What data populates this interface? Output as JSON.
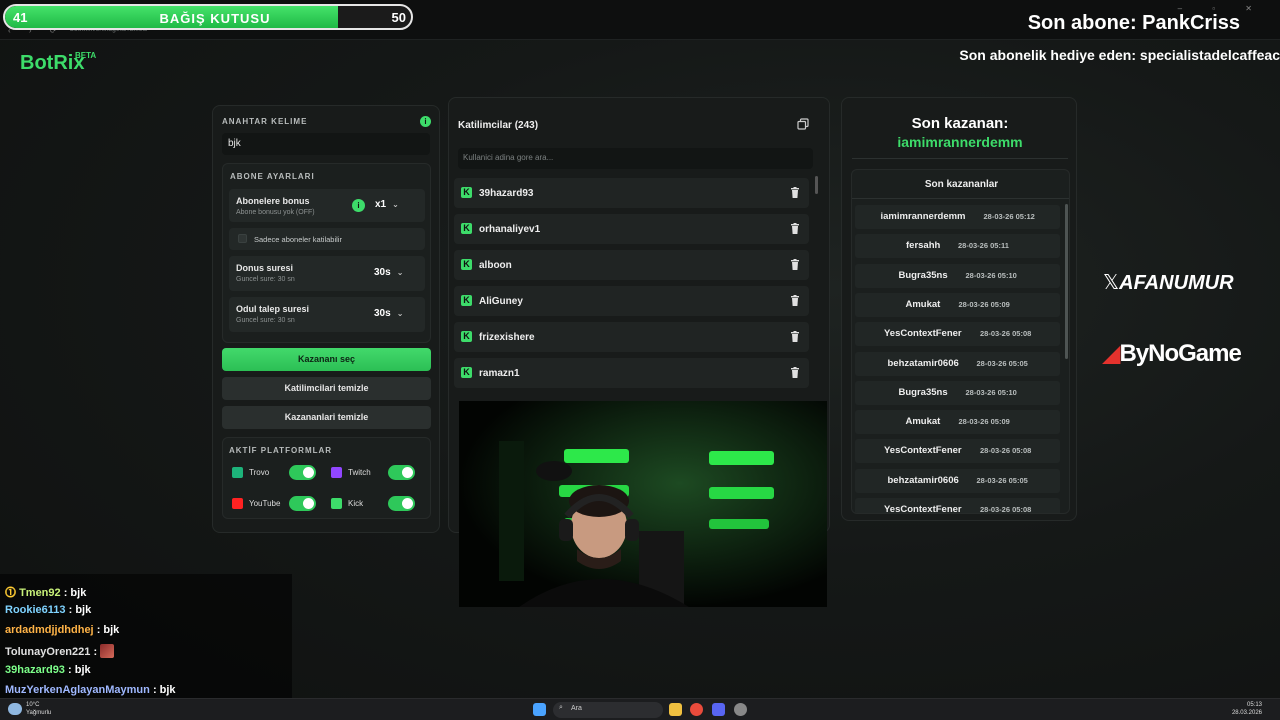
{
  "donation": {
    "current": "41",
    "title": "BAĞIŞ KUTUSU",
    "goal": "50",
    "fill_fraction": 0.82
  },
  "overlay": {
    "last_subscriber": "Son abone: PankCriss",
    "last_gift": "Son abonelik hediye eden: specialistadelcaffeac"
  },
  "browser": {
    "url": "botrix.live/widgets/raffles/"
  },
  "app": {
    "logo": "BotRix",
    "logo_badge": "BETA"
  },
  "settings": {
    "keyword_label": "ANAHTAR KELIME",
    "keyword_value": "bjk",
    "sub_section_label": "ABONE AYARLARI",
    "sub_bonus_title": "Abonelere bonus",
    "sub_bonus_desc": "Abone bonusu yok (OFF)",
    "sub_bonus_value": "x1",
    "sub_only_label": "Sadece aboneler katilabilir",
    "bonus_duration_title": "Donus suresi",
    "bonus_duration_desc": "Guncel sure: 30 sn",
    "bonus_duration_value": "30s",
    "claim_duration_title": "Odul talep suresi",
    "claim_duration_desc": "Guncel sure: 30 sn",
    "claim_duration_value": "30s",
    "pick_winner": "Kazananı seç",
    "clear_participants": "Katilimcilari temizle",
    "clear_winners": "Kazananlari temizle",
    "platforms_label": "AKTİF PLATFORMLAR",
    "platforms": [
      {
        "name": "Trovo",
        "color": "#1db37a",
        "enabled": true
      },
      {
        "name": "Twitch",
        "color": "#9146ff",
        "enabled": true
      },
      {
        "name": "YouTube",
        "color": "#ff2222",
        "enabled": true
      },
      {
        "name": "Kick",
        "color": "#3ddc6a",
        "enabled": true
      }
    ]
  },
  "participants": {
    "title": "Katilimcilar (243)",
    "search_placeholder": "Kullanici adina gore ara...",
    "list": [
      "39hazard93",
      "orhanaliyev1",
      "alboon",
      "AliGuney",
      "frizexishere",
      "ramazn1"
    ]
  },
  "winners": {
    "last_winner_label": "Son kazanan:",
    "last_winner_name": "iamimrannerdemm",
    "list_title": "Son kazananlar",
    "list": [
      {
        "name": "iamimrannerdemm",
        "time": "28-03-26 05:12"
      },
      {
        "name": "fersahh",
        "time": "28-03-26 05:11"
      },
      {
        "name": "Bugra35ns",
        "time": "28-03-26 05:10"
      },
      {
        "name": "Amukat",
        "time": "28-03-26 05:09"
      },
      {
        "name": "YesContextFener",
        "time": "28-03-26 05:08"
      },
      {
        "name": "behzatamir0606",
        "time": "28-03-26 05:05"
      },
      {
        "name": "Bugra35ns",
        "time": "28-03-26 05:10"
      },
      {
        "name": "Amukat",
        "time": "28-03-26 05:09"
      },
      {
        "name": "YesContextFener",
        "time": "28-03-26 05:08"
      },
      {
        "name": "behzatamir0606",
        "time": "28-03-26 05:05"
      },
      {
        "name": "YesContextFener",
        "time": "28-03-26 05:08"
      }
    ]
  },
  "branding": {
    "x_handle": "AFANUMUR",
    "sponsor": "ByNoGame"
  },
  "chat": [
    {
      "user": "Tmen92",
      "color": "#c9f27a",
      "message": ": bjk"
    },
    {
      "user": "Rookie6113",
      "color": "#7fd3ff",
      "message": ": bjk"
    },
    {
      "user": "ardadmdjjdhdhej",
      "color": "#ffb347",
      "message": ": bjk"
    },
    {
      "user": "TolunayOren221",
      "color": "#e0e0e0",
      "message": ":"
    },
    {
      "user": "39hazard93",
      "color": "#7dff8a",
      "message": ": bjk"
    },
    {
      "user": "MuzYerkenAglayanMaymun",
      "color": "#9fb8ff",
      "message": ": bjk"
    }
  ],
  "taskbar": {
    "weather_temp": "10°C",
    "weather_desc": "Yağmurlu",
    "search_label": "Ara",
    "time": "05:13",
    "date": "28.03.2026"
  }
}
